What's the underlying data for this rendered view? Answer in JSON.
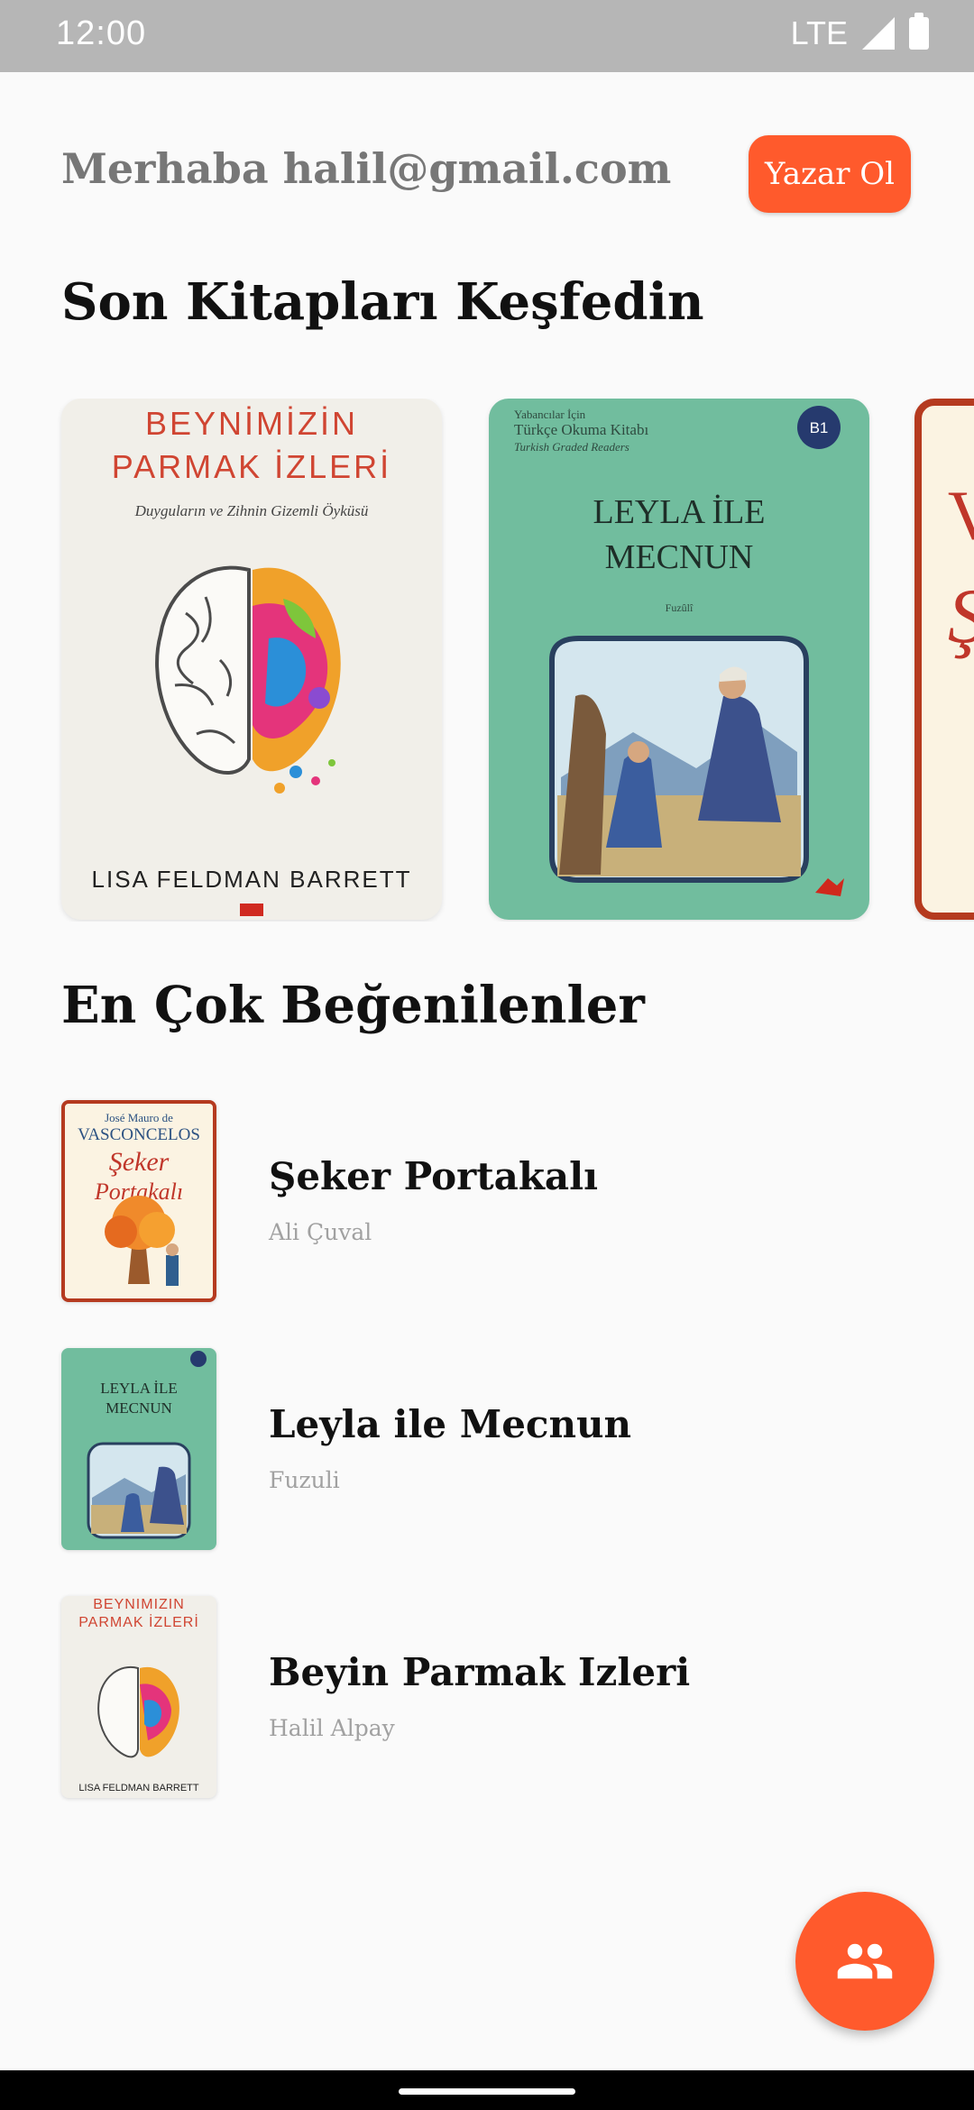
{
  "status_bar": {
    "time": "12:00",
    "network": "LTE"
  },
  "header": {
    "greeting": "Merhaba halil@gmail.com",
    "author_button_label": "Yazar Ol"
  },
  "recent_section": {
    "title": "Son Kitapları Keşfedin",
    "covers": [
      {
        "title_line1": "BEYNİMİZİN",
        "title_line2": "PARMAK İZLERİ",
        "subtitle": "Duyguların ve Zihnin Gizemli Öyküsü",
        "author": "LISA FELDMAN BARRETT"
      },
      {
        "series_line1": "Yabancılar İçin",
        "series_line2": "Türkçe Okuma Kitabı",
        "series_line3": "Turkish Graded Readers",
        "level": "B1",
        "title_line1": "LEYLA İLE",
        "title_line2": "MECNUN",
        "author": "Fuzûlî"
      },
      {
        "visible_letter": "V",
        "visible_letter2": "Ş"
      }
    ]
  },
  "popular_section": {
    "title": "En Çok Beğenilenler",
    "items": [
      {
        "title": "Şeker Portakalı",
        "author": "Ali Çuval",
        "cover": {
          "line1": "José Mauro de",
          "line2": "VASCONCELOS",
          "line3": "Şeker",
          "line4": "Portakalı"
        }
      },
      {
        "title": "Leyla ile Mecnun",
        "author": "Fuzuli",
        "cover": {
          "line1": "LEYLA İLE",
          "line2": "MECNUN"
        }
      },
      {
        "title": "Beyin Parmak Izleri",
        "author": "Halil Alpay",
        "cover": {
          "line1": "BEYNIMIZIN",
          "line2": "PARMAK İZLERİ",
          "line3": "LISA FELDMAN BARRETT"
        }
      }
    ]
  },
  "fab": {
    "icon": "people-icon"
  },
  "colors": {
    "accent": "#ff5a2c",
    "status_bar": "#b6b6b6",
    "background": "#fafafa"
  }
}
